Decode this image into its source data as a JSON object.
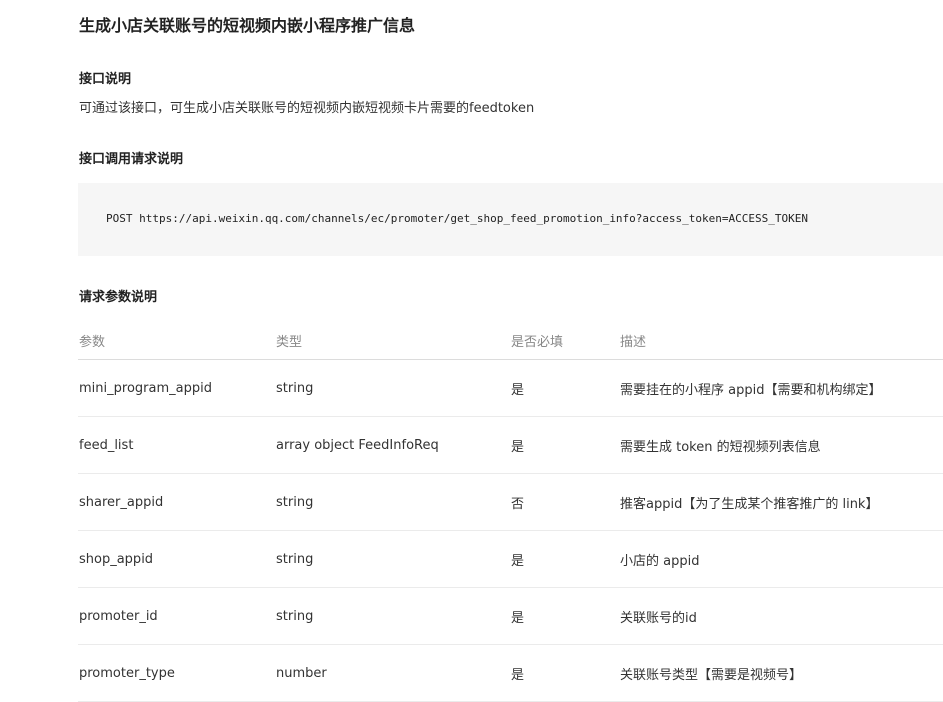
{
  "page": {
    "title": "生成小店关联账号的短视频内嵌小程序推广信息"
  },
  "interface_desc": {
    "heading": "接口说明",
    "text": "可通过该接口，可生成小店关联账号的短视频内嵌短视频卡片需要的feedtoken"
  },
  "request_desc": {
    "heading": "接口调用请求说明",
    "code": "POST https://api.weixin.qq.com/channels/ec/promoter/get_shop_feed_promotion_info?access_token=ACCESS_TOKEN"
  },
  "params": {
    "heading": "请求参数说明",
    "columns": [
      "参数",
      "类型",
      "是否必填",
      "描述"
    ],
    "rows": [
      [
        "mini_program_appid",
        "string",
        "是",
        "需要挂在的小程序 appid【需要和机构绑定】"
      ],
      [
        "feed_list",
        "array object FeedInfoReq",
        "是",
        "需要生成 token 的短视频列表信息"
      ],
      [
        "sharer_appid",
        "string",
        "否",
        "推客appid【为了生成某个推客推广的 link】"
      ],
      [
        "shop_appid",
        "string",
        "是",
        "小店的 appid"
      ],
      [
        "promoter_id",
        "string",
        "是",
        "关联账号的id"
      ],
      [
        "promoter_type",
        "number",
        "是",
        "关联账号类型【需要是视频号】"
      ]
    ]
  }
}
